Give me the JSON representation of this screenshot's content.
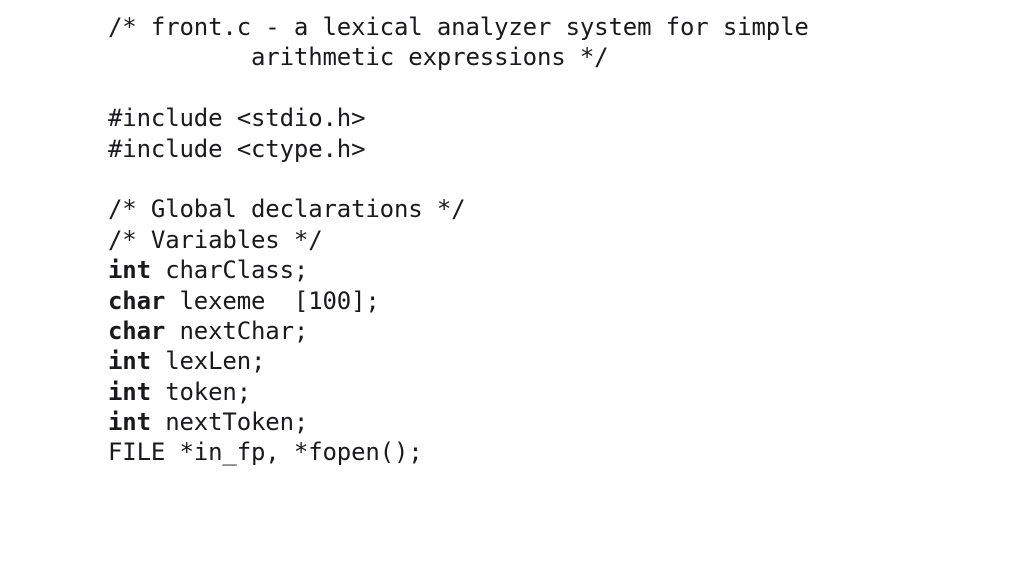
{
  "slide": {
    "background_color": "#ffffff",
    "text_color": "#1a1a1e",
    "title": "front.c - a lexical analyzer system for simple arithmetic expressions"
  },
  "code": {
    "language": "c",
    "lines": [
      {
        "id": "line-1",
        "type": "comment",
        "indent": 0,
        "keyword": "",
        "rest": "/* front.c - a lexical analyzer system for simple"
      },
      {
        "id": "line-2",
        "type": "comment",
        "indent": 10,
        "keyword": "",
        "rest": "arithmetic expressions */"
      },
      {
        "id": "line-3",
        "type": "blank",
        "indent": 0,
        "keyword": "",
        "rest": ""
      },
      {
        "id": "line-4",
        "type": "preprocessor",
        "indent": 0,
        "keyword": "",
        "rest": "#include <stdio.h>"
      },
      {
        "id": "line-5",
        "type": "preprocessor",
        "indent": 0,
        "keyword": "",
        "rest": "#include <ctype.h>"
      },
      {
        "id": "line-6",
        "type": "blank",
        "indent": 0,
        "keyword": "",
        "rest": ""
      },
      {
        "id": "line-7",
        "type": "comment",
        "indent": 0,
        "keyword": "",
        "rest": "/* Global declarations */"
      },
      {
        "id": "line-8",
        "type": "comment",
        "indent": 0,
        "keyword": "",
        "rest": "/* Variables */"
      },
      {
        "id": "line-9",
        "type": "declaration",
        "indent": 0,
        "keyword": "int",
        "rest": " charClass;"
      },
      {
        "id": "line-10",
        "type": "declaration",
        "indent": 0,
        "keyword": "char",
        "rest": " lexeme  [100];"
      },
      {
        "id": "line-11",
        "type": "declaration",
        "indent": 0,
        "keyword": "char",
        "rest": " nextChar;"
      },
      {
        "id": "line-12",
        "type": "declaration",
        "indent": 0,
        "keyword": "int",
        "rest": " lexLen;"
      },
      {
        "id": "line-13",
        "type": "declaration",
        "indent": 0,
        "keyword": "int",
        "rest": " token;"
      },
      {
        "id": "line-14",
        "type": "declaration",
        "indent": 0,
        "keyword": "int",
        "rest": " nextToken;"
      },
      {
        "id": "line-15",
        "type": "declaration",
        "indent": 0,
        "keyword": "",
        "rest": "FILE *in_fp, *fopen();"
      }
    ]
  }
}
